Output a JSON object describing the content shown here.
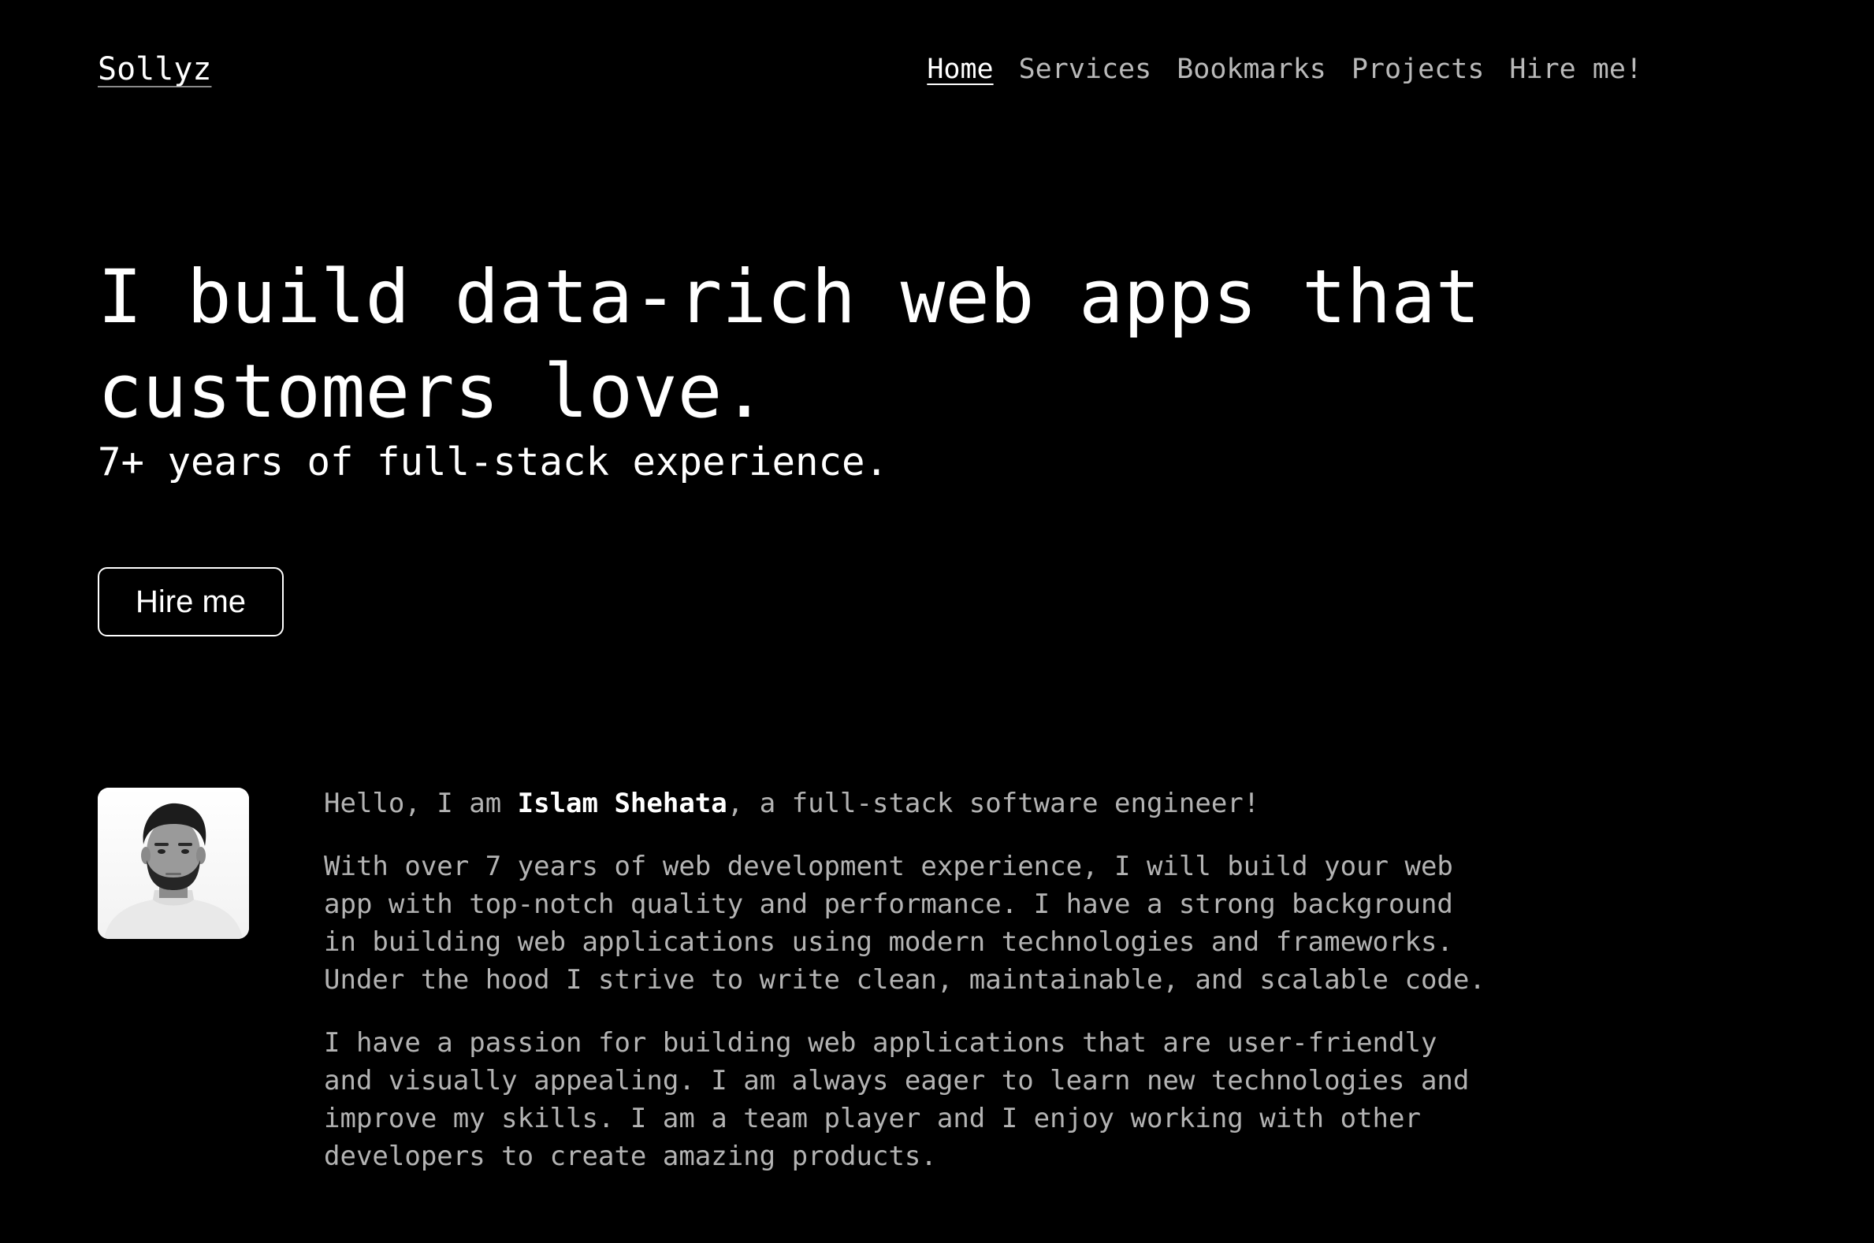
{
  "brand": {
    "name": "Sollyz"
  },
  "nav": {
    "items": [
      {
        "label": "Home",
        "active": true
      },
      {
        "label": "Services",
        "active": false
      },
      {
        "label": "Bookmarks",
        "active": false
      },
      {
        "label": "Projects",
        "active": false
      },
      {
        "label": "Hire me!",
        "active": false
      }
    ]
  },
  "hero": {
    "title": "I build data-rich web apps that customers love.",
    "subtitle": "7+ years of full-stack experience.",
    "cta_label": "Hire me"
  },
  "about": {
    "avatar_icon": "portrait-photo",
    "intro_prefix": "Hello, I am ",
    "name": "Islam Shehata",
    "intro_suffix": ", a full-stack software engineer!",
    "paragraph_1": "With over 7 years of web development experience, I will build your web app with top-notch quality and performance. I have a strong background in building web applications using modern technologies and frameworks. Under the hood I strive to write clean, maintainable, and scalable code.",
    "paragraph_2": "I have a passion for building web applications that are user-friendly and visually appealing. I am always eager to learn new technologies and improve my skills. I am a team player and I enjoy working with other developers to create amazing products."
  },
  "colors": {
    "background": "#000000",
    "text_primary": "#ffffff",
    "text_muted": "#b3b3b3"
  }
}
